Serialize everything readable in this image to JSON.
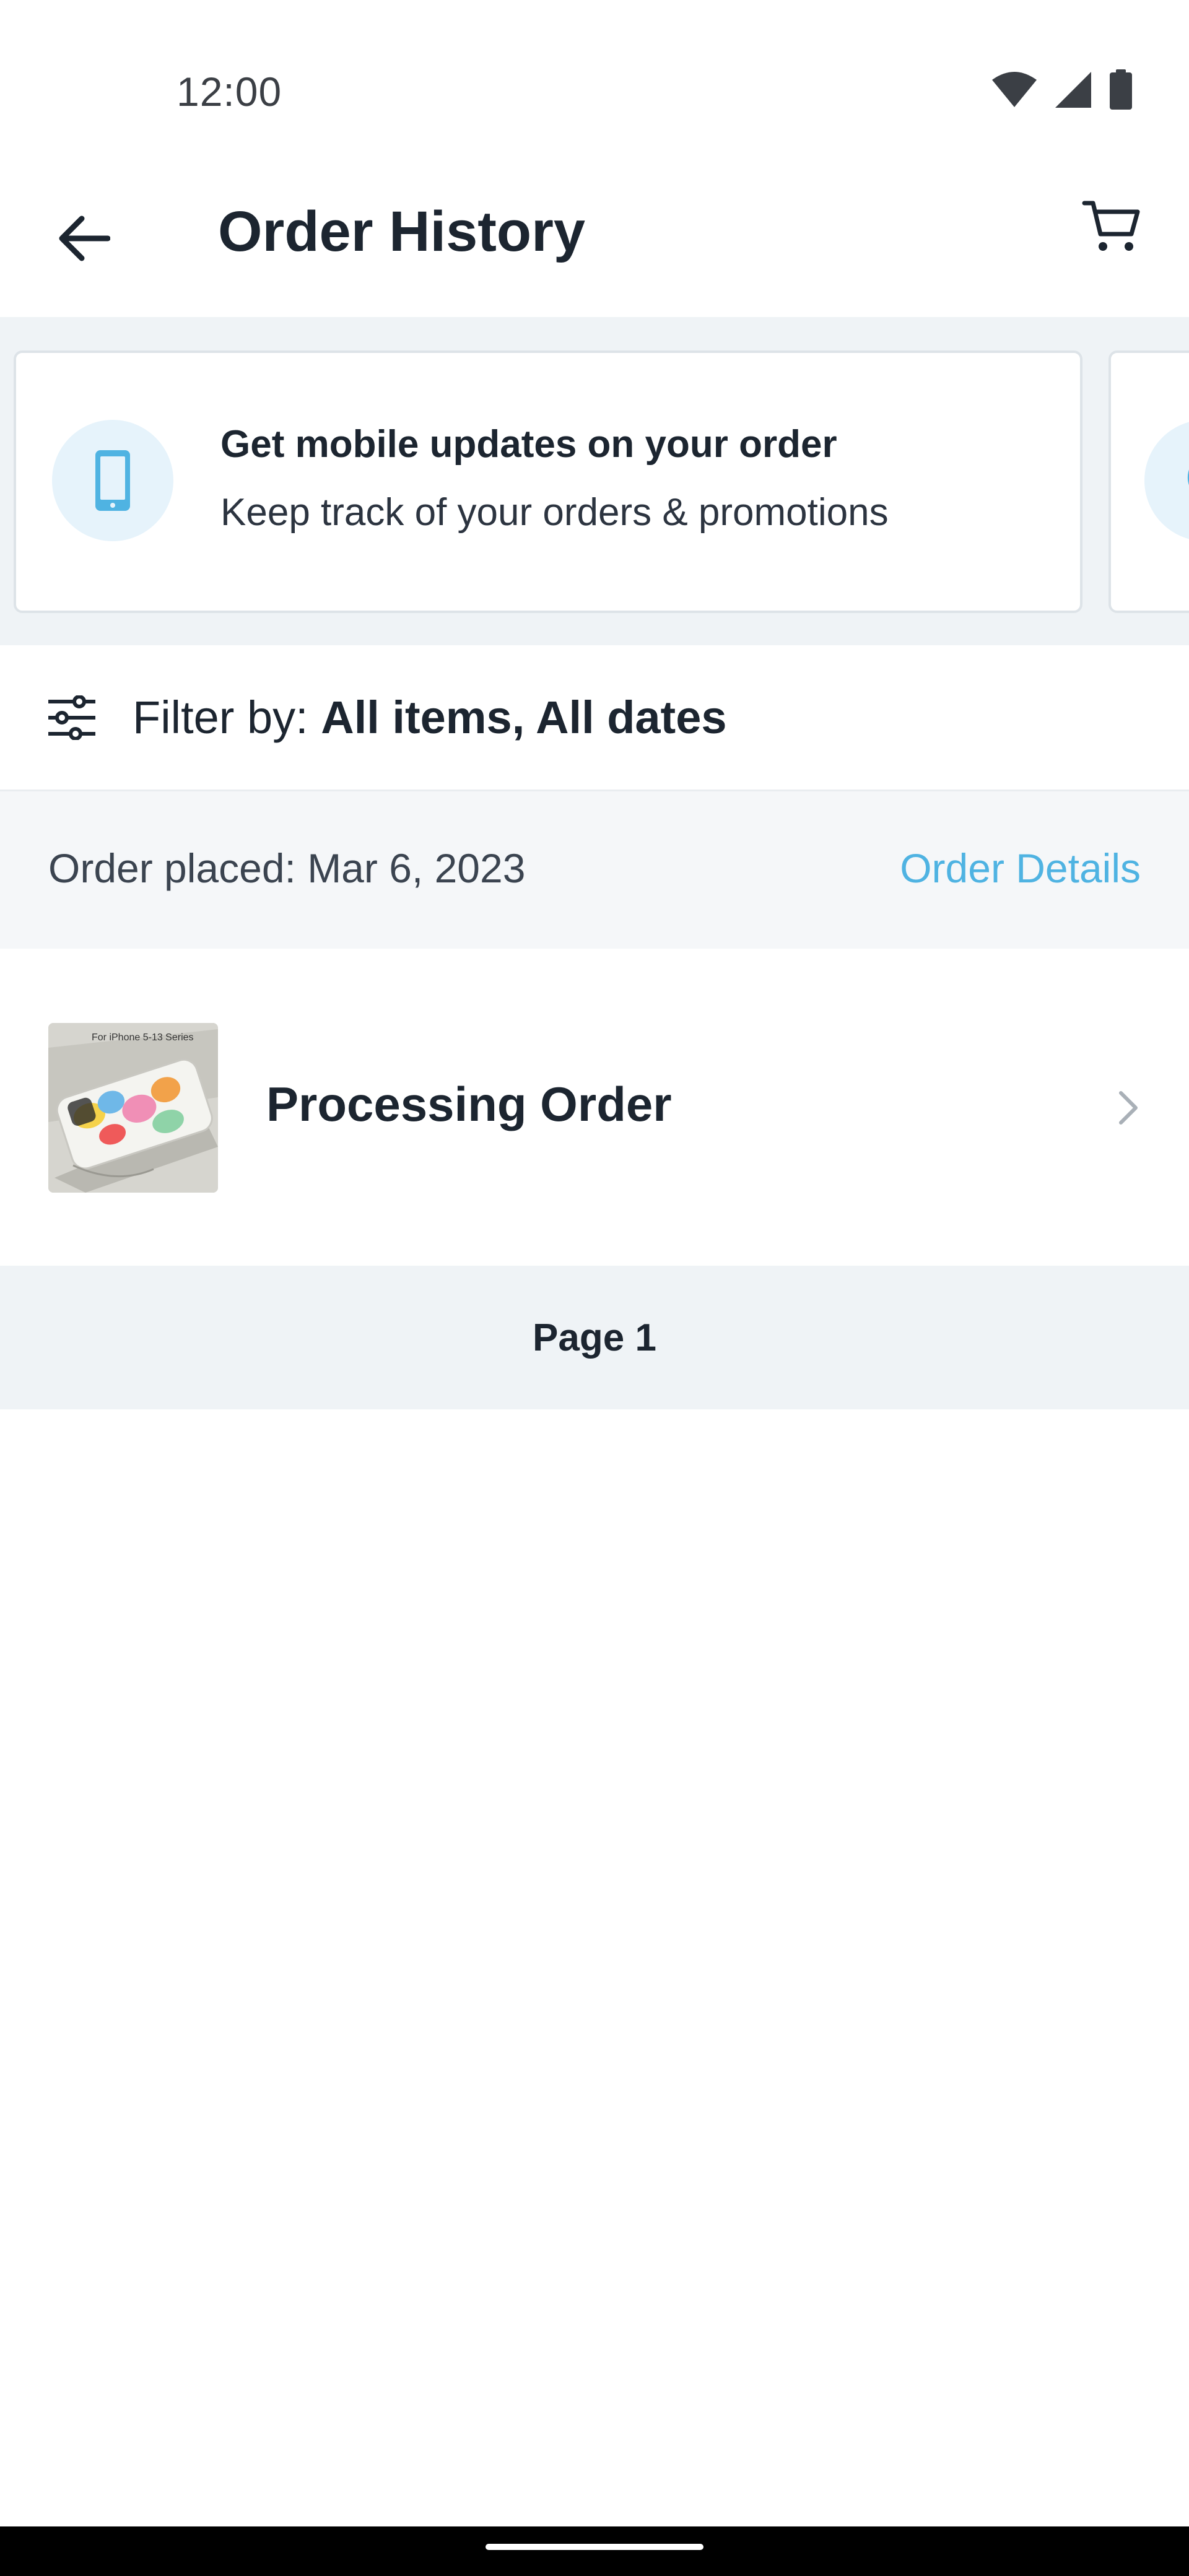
{
  "status_bar": {
    "time": "12:00",
    "icons": [
      "wifi-icon",
      "signal-icon",
      "battery-icon"
    ]
  },
  "app_bar": {
    "title": "Order History",
    "back_icon": "back-arrow-icon",
    "cart_icon": "cart-icon"
  },
  "promos": [
    {
      "icon": "phone-icon",
      "title": "Get mobile updates on your order",
      "subtitle": "Keep track of your orders & promotions"
    },
    {
      "icon": "chat-icon",
      "title": "",
      "subtitle": ""
    }
  ],
  "filter": {
    "icon": "sliders-icon",
    "label": "Filter by:",
    "value": "All items, All dates"
  },
  "order": {
    "placed_text": "Order placed: Mar 6, 2023",
    "details_link": "Order Details",
    "status": "Processing Order",
    "thumbnail_caption": "For iPhone 5-13 Series"
  },
  "pagination": {
    "label": "Page 1"
  },
  "colors": {
    "accent": "#4fb3e2",
    "text_primary": "#1c2530",
    "section_bg": "#eff3f6",
    "icon_circle_bg": "#e6f3fb"
  }
}
